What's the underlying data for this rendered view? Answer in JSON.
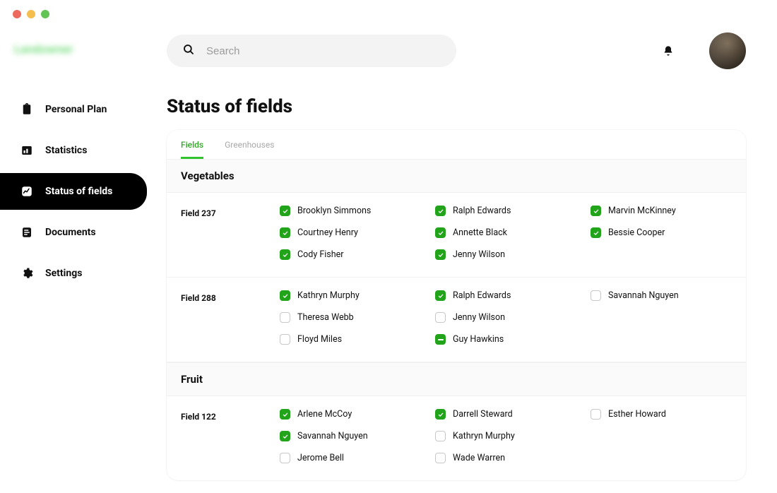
{
  "logo_text": "Landowner",
  "search": {
    "placeholder": "Search"
  },
  "nav": {
    "personal_plan": "Personal Plan",
    "statistics": "Statistics",
    "status_of_fields": "Status of fields",
    "documents": "Documents",
    "settings": "Settings"
  },
  "page_title": "Status of fields",
  "tabs": {
    "fields": "Fields",
    "greenhouses": "Greenhouses"
  },
  "sections": {
    "vegetables": {
      "title": "Vegetables",
      "field237": {
        "label": "Field 237",
        "p1": "Brooklyn Simmons",
        "p2": "Ralph Edwards",
        "p3": "Marvin McKinney",
        "p4": "Courtney Henry",
        "p5": "Annette Black",
        "p6": "Bessie Cooper",
        "p7": "Cody Fisher",
        "p8": "Jenny Wilson"
      },
      "field288": {
        "label": "Field 288",
        "p1": "Kathryn Murphy",
        "p2": "Ralph Edwards",
        "p3": "Savannah Nguyen",
        "p4": "Theresa Webb",
        "p5": "Jenny Wilson",
        "p6": "Floyd Miles",
        "p7": "Guy Hawkins"
      }
    },
    "fruit": {
      "title": "Fruit",
      "field122": {
        "label": "Field 122",
        "p1": "Arlene McCoy",
        "p2": "Darrell Steward",
        "p3": "Esther Howard",
        "p4": "Savannah Nguyen",
        "p5": "Kathryn Murphy",
        "p6": "Jerome Bell",
        "p7": "Wade Warren"
      }
    }
  }
}
